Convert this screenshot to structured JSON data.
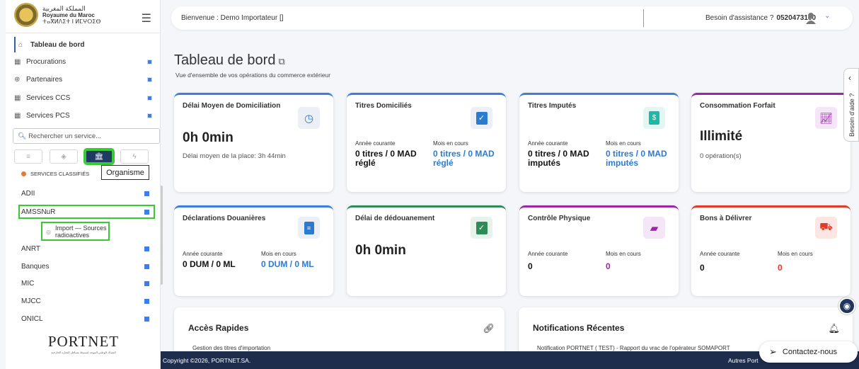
{
  "logo": {
    "line1": "المملكة المغربية",
    "line2": "Royaume du Maroc",
    "line3": "ⵜⴰⴳⵍⴷⵉⵜ ⵏ ⵍⵎⵖⵔⵉⴱ"
  },
  "sidebar": {
    "items": [
      {
        "label": "Tableau de bord",
        "icon": "home-icon"
      },
      {
        "label": "Procurations",
        "icon": "calendar-icon"
      },
      {
        "label": "Partenaires",
        "icon": "globe-icon"
      },
      {
        "label": "Services CCS",
        "icon": "calendar-icon"
      },
      {
        "label": "Services PCS",
        "icon": "calendar-icon"
      }
    ],
    "search_placeholder": "Rechercher un service...",
    "tooltip": "Organisme",
    "classified_header": "SERVICES CLASSIFIÉS",
    "categories": [
      "ADII",
      "AMSSNuR",
      "ANRT",
      "Banques",
      "MIC",
      "MJCC",
      "ONICL"
    ],
    "sub_item": "Import — Sources radioactives",
    "portnet": "PORTNET",
    "portnet_sub": "الشباك الوطني الموحد لتبسيط مساطر التجارة الخارجية"
  },
  "header": {
    "welcome": "Bienvenue : Demo Importateur []",
    "assist_label": "Besoin d'assistance ?",
    "assist_phone": "0520473100"
  },
  "page": {
    "title": "Tableau de bord",
    "subtitle": "Vue d'ensemble de vos opérations du commerce extérieur"
  },
  "cards": {
    "c1": {
      "title": "Délai Moyen de Domiciliation",
      "big": "0h 0min",
      "desc": "Délai moyen de la place: 3h 44min"
    },
    "c2": {
      "title": "Titres Domiciliés",
      "col1": "Année courante",
      "col2": "Mois en cours",
      "val1": "0 titres / 0 MAD réglé",
      "val2": "0 titres / 0 MAD réglé"
    },
    "c3": {
      "title": "Titres Imputés",
      "col1": "Année courante",
      "col2": "Mois en cours",
      "val1": "0 titres / 0 MAD imputés",
      "val2": "0 titres / 0 MAD imputés"
    },
    "c4": {
      "title": "Consommation Forfait",
      "big": "Illimité",
      "desc": "0 opération(s)"
    },
    "c5": {
      "title": "Déclarations Douanières",
      "col1": "Année courante",
      "col2": "Mois en cours",
      "val1": "0 DUM / 0 ML",
      "val2": "0 DUM / 0 ML"
    },
    "c6": {
      "title": "Délai de dédouanement",
      "big": "0h 0min"
    },
    "c7": {
      "title": "Contrôle Physique",
      "col1": "Année courante",
      "col2": "Mois en cours",
      "val1": "0",
      "val2": "0"
    },
    "c8": {
      "title": "Bons à Délivrer",
      "col1": "Année courante",
      "col2": "Mois en cours",
      "val1": "0",
      "val2": "0"
    }
  },
  "panels": {
    "quick": {
      "title": "Accès Rapides",
      "line": "Gestion des titres d'importation"
    },
    "notif": {
      "title": "Notifications Récentes",
      "line": "Notification PORTNET ( TEST) - Rapport du vrac de l'opérateur SOMAPORT"
    }
  },
  "footer": {
    "copyright": "Copyright ©2026, PORTNET.SA.",
    "links": "Autres Port"
  },
  "aide": "Besoin d'aide ?",
  "contact": "Contactez-nous",
  "colors": {
    "accent_blue": "#2b7bd1",
    "purple": "#9b27a8",
    "red": "#e03a2a",
    "green": "#2e8b57",
    "highlight": "#39c932"
  }
}
